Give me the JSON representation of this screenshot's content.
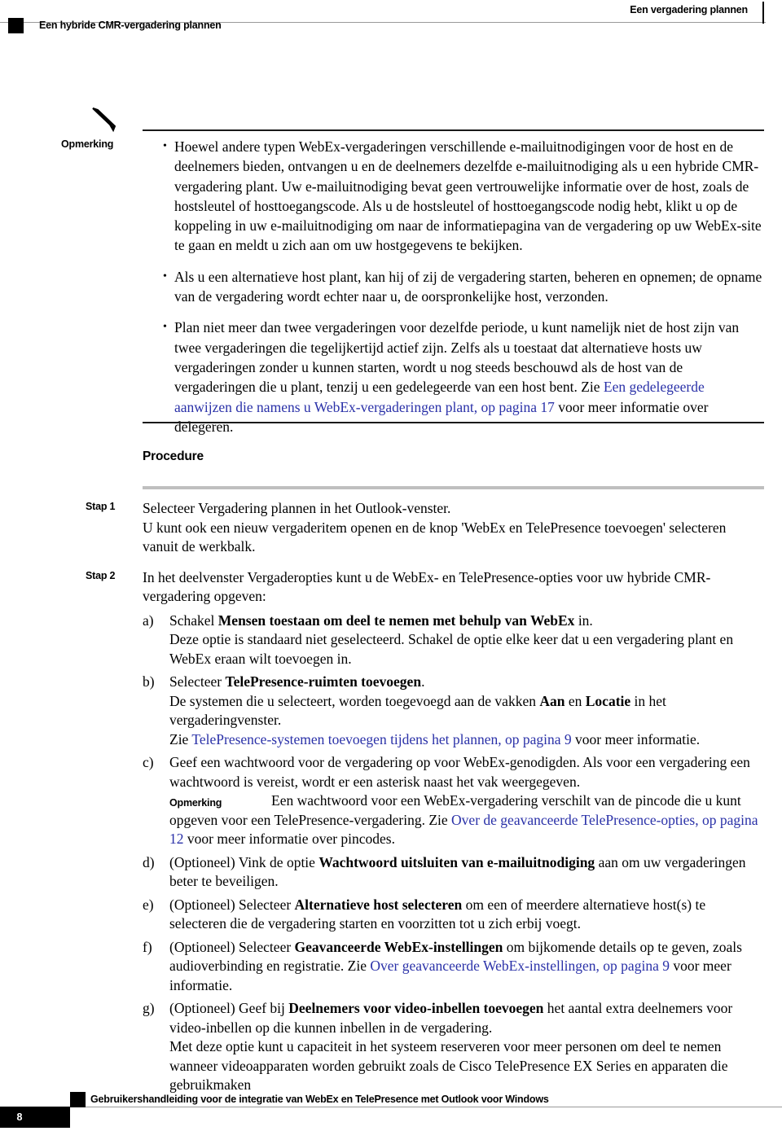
{
  "header": {
    "left_title": "Een hybride CMR-vergadering plannen",
    "right_title": "Een vergadering plannen"
  },
  "note": {
    "icon": "pencil-icon",
    "label": "Opmerking",
    "bullets": [
      {
        "id": "bullet-1",
        "runs": [
          {
            "text": "Hoewel andere typen WebEx-vergaderingen verschillende e-mailuitnodigingen voor de host en de deelnemers bieden, ontvangen u en de deelnemers dezelfde e-mailuitnodiging als u een hybride CMR-vergadering plant. Uw e-mailuitnodiging bevat geen vertrouwelijke informatie over de host, zoals de hostsleutel of hosttoegangscode. Als u de hostsleutel of hosttoegangscode nodig hebt, klikt u op de koppeling in uw e-mailuitnodiging om naar de informatiepagina van de vergadering op uw WebEx-site te gaan en meldt u zich aan om uw hostgegevens te bekijken.",
            "style": "normal"
          }
        ]
      },
      {
        "id": "bullet-2",
        "runs": [
          {
            "text": "Als u een alternatieve host plant, kan hij of zij de vergadering starten, beheren en opnemen; de opname van de vergadering wordt echter naar u, de oorspronkelijke host, verzonden.",
            "style": "normal"
          }
        ]
      },
      {
        "id": "bullet-3",
        "runs": [
          {
            "text": "Plan niet meer dan twee vergaderingen voor dezelfde periode, u kunt namelijk niet de host zijn van twee vergaderingen die tegelijkertijd actief zijn. Zelfs als u toestaat dat alternatieve hosts uw vergaderingen zonder u kunnen starten, wordt u nog steeds beschouwd als de host van de vergaderingen die u plant, tenzij u een gedelegeerde van een host bent. Zie ",
            "style": "normal"
          },
          {
            "text": "Een gedelegeerde aanwijzen die namens u WebEx-vergaderingen plant,  op pagina 17",
            "style": "link"
          },
          {
            "text": " voor meer informatie over delegeren.",
            "style": "normal"
          }
        ]
      }
    ]
  },
  "procedure": {
    "heading": "Procedure",
    "steps": [
      {
        "label": "Stap 1",
        "paragraphs": [
          {
            "runs": [
              {
                "text": "Selecteer Vergadering plannen in het Outlook-venster.",
                "style": "normal"
              }
            ]
          },
          {
            "runs": [
              {
                "text": "U kunt ook een nieuw vergaderitem openen en de knop 'WebEx en TelePresence toevoegen' selecteren vanuit de werkbalk.",
                "style": "normal"
              }
            ]
          }
        ],
        "sublist": []
      },
      {
        "label": "Stap 2",
        "paragraphs": [
          {
            "runs": [
              {
                "text": "In het deelvenster Vergaderopties kunt u de WebEx- en TelePresence-opties voor uw hybride CMR-vergadering opgeven:",
                "style": "normal"
              }
            ]
          }
        ],
        "sublist": [
          {
            "marker": "a)",
            "paragraphs": [
              {
                "runs": [
                  {
                    "text": "Schakel ",
                    "style": "normal"
                  },
                  {
                    "text": "Mensen toestaan om deel te nemen met behulp van WebEx",
                    "style": "bold"
                  },
                  {
                    "text": " in.",
                    "style": "normal"
                  }
                ]
              },
              {
                "runs": [
                  {
                    "text": "Deze optie is standaard niet geselecteerd. Schakel de optie elke keer dat u een vergadering plant en WebEx eraan wilt toevoegen in.",
                    "style": "normal"
                  }
                ]
              }
            ]
          },
          {
            "marker": "b)",
            "paragraphs": [
              {
                "runs": [
                  {
                    "text": "Selecteer ",
                    "style": "normal"
                  },
                  {
                    "text": "TelePresence-ruimten toevoegen",
                    "style": "bold"
                  },
                  {
                    "text": ".",
                    "style": "normal"
                  }
                ]
              },
              {
                "runs": [
                  {
                    "text": "De systemen die u selecteert, worden toegevoegd aan de vakken ",
                    "style": "normal"
                  },
                  {
                    "text": "Aan",
                    "style": "bold"
                  },
                  {
                    "text": " en ",
                    "style": "normal"
                  },
                  {
                    "text": "Locatie",
                    "style": "bold"
                  },
                  {
                    "text": " in het vergaderingvenster.",
                    "style": "normal"
                  }
                ]
              },
              {
                "runs": [
                  {
                    "text": "Zie ",
                    "style": "normal"
                  },
                  {
                    "text": "TelePresence-systemen toevoegen tijdens het plannen,  op pagina 9",
                    "style": "link"
                  },
                  {
                    "text": " voor meer informatie.",
                    "style": "normal"
                  }
                ]
              }
            ]
          },
          {
            "marker": "c)",
            "paragraphs": [
              {
                "runs": [
                  {
                    "text": "Geef een wachtwoord voor de vergadering op voor WebEx-genodigden. Als voor een vergadering een wachtwoord is vereist, wordt er een asterisk naast het vak weergegeven.",
                    "style": "normal"
                  }
                ]
              }
            ],
            "inline_note": {
              "label": "Opmerking",
              "runs": [
                {
                  "text": "Een wachtwoord voor een WebEx-vergadering verschilt van de pincode die u kunt opgeven voor een TelePresence-vergadering. Zie ",
                  "style": "normal"
                },
                {
                  "text": "Over de geavanceerde TelePresence-opties,  op pagina 12",
                  "style": "link"
                },
                {
                  "text": " voor meer informatie over pincodes.",
                  "style": "normal"
                }
              ]
            }
          },
          {
            "marker": "d)",
            "paragraphs": [
              {
                "runs": [
                  {
                    "text": "(Optioneel) Vink de optie ",
                    "style": "normal"
                  },
                  {
                    "text": "Wachtwoord uitsluiten van e-mailuitnodiging",
                    "style": "bold"
                  },
                  {
                    "text": " aan om uw vergaderingen beter te beveiligen.",
                    "style": "normal"
                  }
                ]
              }
            ]
          },
          {
            "marker": "e)",
            "paragraphs": [
              {
                "runs": [
                  {
                    "text": "(Optioneel) Selecteer ",
                    "style": "normal"
                  },
                  {
                    "text": "Alternatieve host selecteren",
                    "style": "bold"
                  },
                  {
                    "text": " om een of meerdere alternatieve host(s) te selecteren die de vergadering starten en voorzitten tot u zich erbij voegt.",
                    "style": "normal"
                  }
                ]
              }
            ]
          },
          {
            "marker": "f)",
            "paragraphs": [
              {
                "runs": [
                  {
                    "text": "(Optioneel) Selecteer ",
                    "style": "normal"
                  },
                  {
                    "text": "Geavanceerde WebEx-instellingen",
                    "style": "bold"
                  },
                  {
                    "text": " om bijkomende details op te geven, zoals audioverbinding en registratie. Zie ",
                    "style": "normal"
                  },
                  {
                    "text": "Over geavanceerde WebEx-instellingen,  op pagina 9",
                    "style": "link"
                  },
                  {
                    "text": " voor meer informatie.",
                    "style": "normal"
                  }
                ]
              }
            ]
          },
          {
            "marker": "g)",
            "paragraphs": [
              {
                "runs": [
                  {
                    "text": "(Optioneel) Geef bij ",
                    "style": "normal"
                  },
                  {
                    "text": "Deelnemers voor video-inbellen toevoegen",
                    "style": "bold"
                  },
                  {
                    "text": " het aantal extra deelnemers voor video-inbellen op die kunnen inbellen in de vergadering.",
                    "style": "normal"
                  }
                ]
              },
              {
                "runs": [
                  {
                    "text": "Met deze optie kunt u capaciteit in het systeem reserveren voor meer personen om deel te nemen wanneer videoapparaten worden gebruikt zoals de Cisco TelePresence EX Series en apparaten die gebruikmaken",
                    "style": "normal"
                  }
                ]
              }
            ]
          }
        ]
      }
    ]
  },
  "footer": {
    "text": "Gebruikershandleiding voor de integratie van WebEx en TelePresence met Outlook voor Windows",
    "page_number": "8"
  },
  "colors": {
    "link": "#2a31a8",
    "rule_dark": "#1a1a1a",
    "rule_light": "#9a9a9a",
    "procedure_rule": "#bfbfbf"
  }
}
